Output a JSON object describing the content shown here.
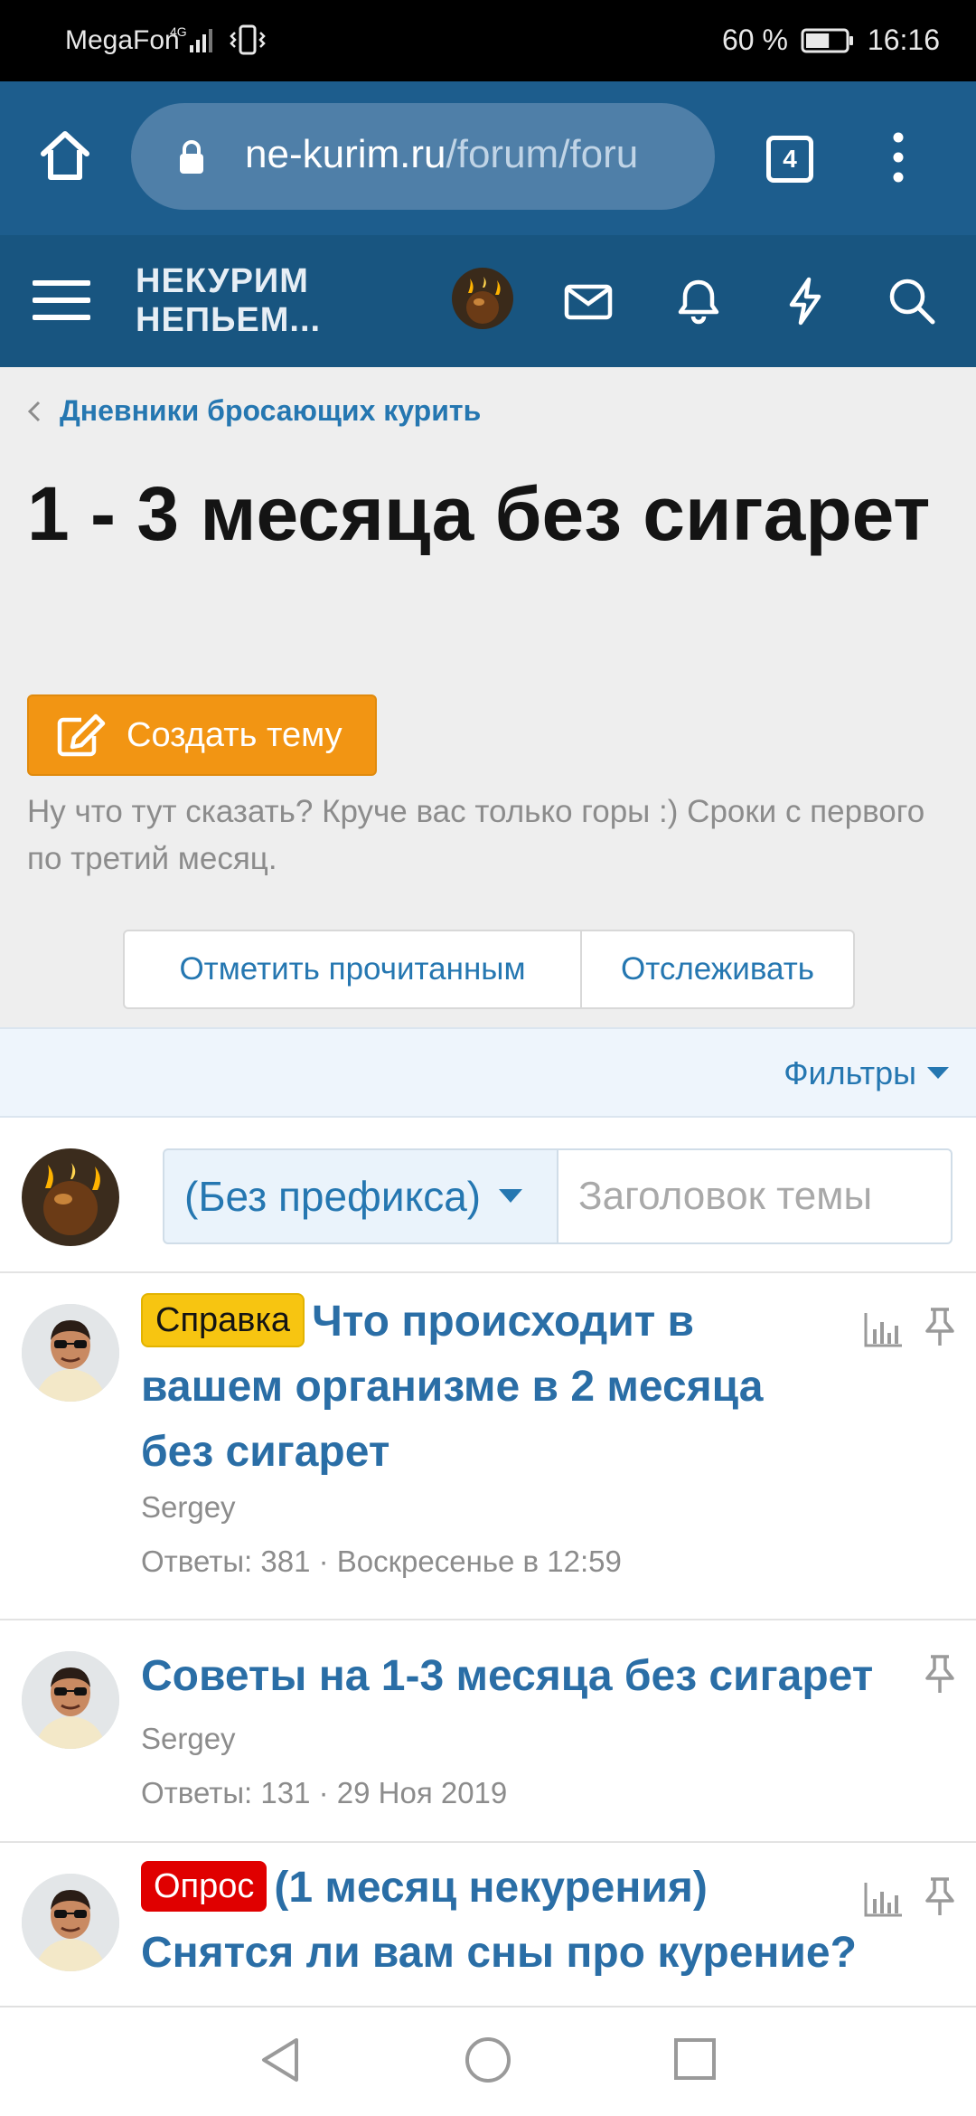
{
  "status_bar": {
    "carrier": "MegaFon",
    "network": "4G",
    "battery_percent": "60 %",
    "battery_level": 0.6,
    "time": "16:16"
  },
  "browser": {
    "url_domain": "ne-kurim.ru",
    "url_path": "/forum/foru",
    "tab_count": "4"
  },
  "site_header": {
    "logo_line1": "НЕКУРИМ",
    "logo_line2": "НЕПЬЕМ..."
  },
  "breadcrumb": {
    "label": "Дневники бросающих курить"
  },
  "forum": {
    "title": "1 - 3 месяца без сигарет",
    "create_button": "Создать тему",
    "description": "Ну что тут сказать? Круче вас только горы :) Сроки с первого по третий месяц.",
    "mark_read_button": "Отметить прочитанным",
    "watch_button": "Отслеживать",
    "filters_label": "Фильтры"
  },
  "quick_thread": {
    "prefix_selected": "(Без префикса)",
    "title_placeholder": "Заголовок темы"
  },
  "threads": [
    {
      "label": "Справка",
      "label_color": "#f7c511",
      "title": "Что происходит в вашем организме в 2 месяца без сигарет",
      "author": "Sergey",
      "meta": "Ответы: 381 · Воскресенье в 12:59",
      "has_poll_icon": true,
      "pinned": true
    },
    {
      "label": "",
      "title": "Советы на 1-3 месяца без сигарет",
      "author": "Sergey",
      "meta": "Ответы: 131 · 29 Ноя 2019",
      "has_poll_icon": false,
      "pinned": true
    },
    {
      "label": "Опрос",
      "label_color": "#e00000",
      "title": "(1 месяц некурения) Снятся ли вам сны про курение?",
      "author": "",
      "meta": "",
      "has_poll_icon": true,
      "pinned": true
    }
  ],
  "colors": {
    "browser_bar": "#1d5d8d",
    "site_header": "#185580",
    "link": "#2577b1",
    "accent_button": "#f29513"
  }
}
